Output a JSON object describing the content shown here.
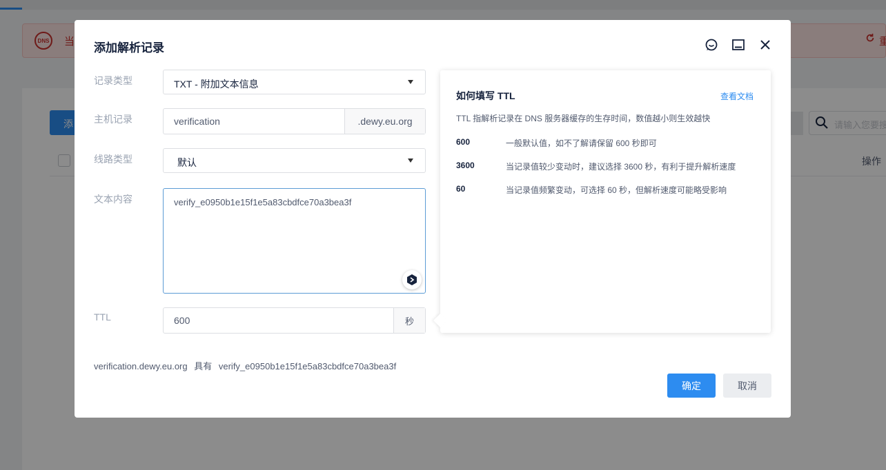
{
  "background": {
    "alert_icon_text": "DNS",
    "alert_text": "当",
    "alert_action": "重",
    "add_button_label": "添",
    "search_placeholder": "请输入您要搜",
    "operations_header": "操作"
  },
  "modal": {
    "title": "添加解析记录",
    "fields": {
      "record_type": {
        "label": "记录类型",
        "value": "TXT - 附加文本信息"
      },
      "host": {
        "label": "主机记录",
        "value": "verification",
        "suffix": ".dewy.eu.org"
      },
      "line": {
        "label": "线路类型",
        "value": "默认"
      },
      "content": {
        "label": "文本内容",
        "value": "verify_e0950b1e15f1e5a83cbdfce70a3bea3f"
      },
      "ttl": {
        "label": "TTL",
        "value": "600",
        "unit": "秒"
      }
    },
    "help": {
      "title": "如何填写 TTL",
      "doc_link": "查看文档",
      "description": "TTL 指解析记录在 DNS 服务器缓存的生存时间，数值越小则生效越快",
      "rows": [
        {
          "value": "600",
          "text": "一般默认值，如不了解请保留 600 秒即可"
        },
        {
          "value": "3600",
          "text": "当记录值较少变动时，建议选择 3600 秒，有利于提升解析速度"
        },
        {
          "value": "60",
          "text": "当记录值频繁变动，可选择 60 秒，但解析速度可能略受影响"
        }
      ]
    },
    "summary": {
      "domain": "verification.dewy.eu.org",
      "connector": "具有",
      "value": "verify_e0950b1e15f1e5a83cbdfce70a3bea3f"
    },
    "buttons": {
      "ok": "确定",
      "cancel": "取消"
    }
  },
  "colors": {
    "primary": "#2d8cf0",
    "alert": "#c9302c"
  }
}
